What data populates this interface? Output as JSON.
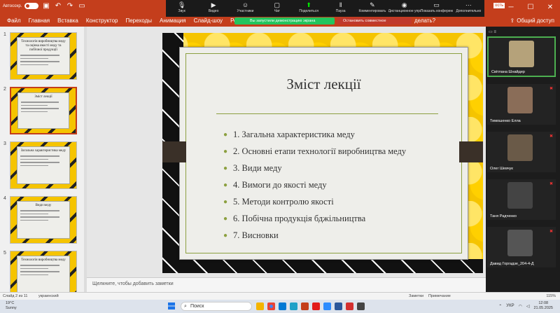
{
  "titlebar": {
    "title": "",
    "warning_badge": "ость"
  },
  "ribbon": {
    "tabs": [
      "Файл",
      "Главная",
      "Вставка",
      "Конструктор",
      "Переходы",
      "Анимация",
      "Слайд-шоу",
      "Рецен"
    ],
    "help_tail": "делать?",
    "share_label": "Общий доступ"
  },
  "zoom": {
    "buttons": [
      {
        "label": "Звук",
        "icon": "microphone-icon"
      },
      {
        "label": "Видео",
        "icon": "video-icon"
      },
      {
        "label": "Участники",
        "icon": "participants-icon",
        "count": "5"
      },
      {
        "label": "Чат",
        "icon": "chat-icon"
      },
      {
        "label": "Поделиться",
        "icon": "share-screen-icon"
      },
      {
        "label": "Пауза",
        "icon": "pause-icon"
      },
      {
        "label": "Комментировать",
        "icon": "annotate-icon"
      },
      {
        "label": "Дистанционное управление",
        "icon": "remote-control-icon"
      },
      {
        "label": "Показать конференцию",
        "icon": "show-meeting-icon"
      },
      {
        "label": "Дополнительно",
        "icon": "more-icon"
      }
    ],
    "sharing_text": "Вы запустили демонстрацию экрана",
    "stop_text": "Остановить совместное использование"
  },
  "thumbnails": [
    {
      "num": "1",
      "title": "Технологія виробництва меду та оцінка якості меду та побічної продукції",
      "selected": false
    },
    {
      "num": "2",
      "title": "Зміст лекції",
      "selected": true
    },
    {
      "num": "3",
      "title": "Загальна характеристика меду",
      "selected": false
    },
    {
      "num": "4",
      "title": "Види меду",
      "selected": false
    },
    {
      "num": "5",
      "title": "Технологія виробництва меду",
      "selected": false
    }
  ],
  "slide": {
    "title": "Зміст лекції",
    "items": [
      "1. Загальна характеристика меду",
      "2. Основні етапи технології виробництва меду",
      "3. Види меду",
      "4. Вимоги до якості меду",
      "5. Методи контролю якості",
      "6. Побічна продукція бджільництва",
      "7. Висновки"
    ],
    "accent": "#8ca040"
  },
  "notes": {
    "placeholder": "Щелкните, чтобы добавить заметки"
  },
  "participants": [
    {
      "name": "Світлана Шнайдер",
      "active": true,
      "color": "#b5a27a"
    },
    {
      "name": "Тимошенко Елла",
      "active": false,
      "color": "#8a6d58"
    },
    {
      "name": "Олег Шевчук",
      "active": false,
      "color": "#6a5a48"
    },
    {
      "name": "Таня Радченко",
      "active": false,
      "color": "#444444"
    },
    {
      "name": "Давид Горгадзе_204-4-Д",
      "active": false,
      "color": "#555555"
    }
  ],
  "status": {
    "slide_counter": "Слайд 2 из 11",
    "language": "украинский",
    "notes_btn": "Заметки",
    "comments_btn": "Примечание",
    "zoom_level": "115%"
  },
  "taskbar": {
    "weather_temp": "19°C",
    "weather_desc": "Sunny",
    "search_placeholder": "Поиск",
    "lang": "УКР",
    "time": "12:08",
    "date": "21.05.2025"
  }
}
